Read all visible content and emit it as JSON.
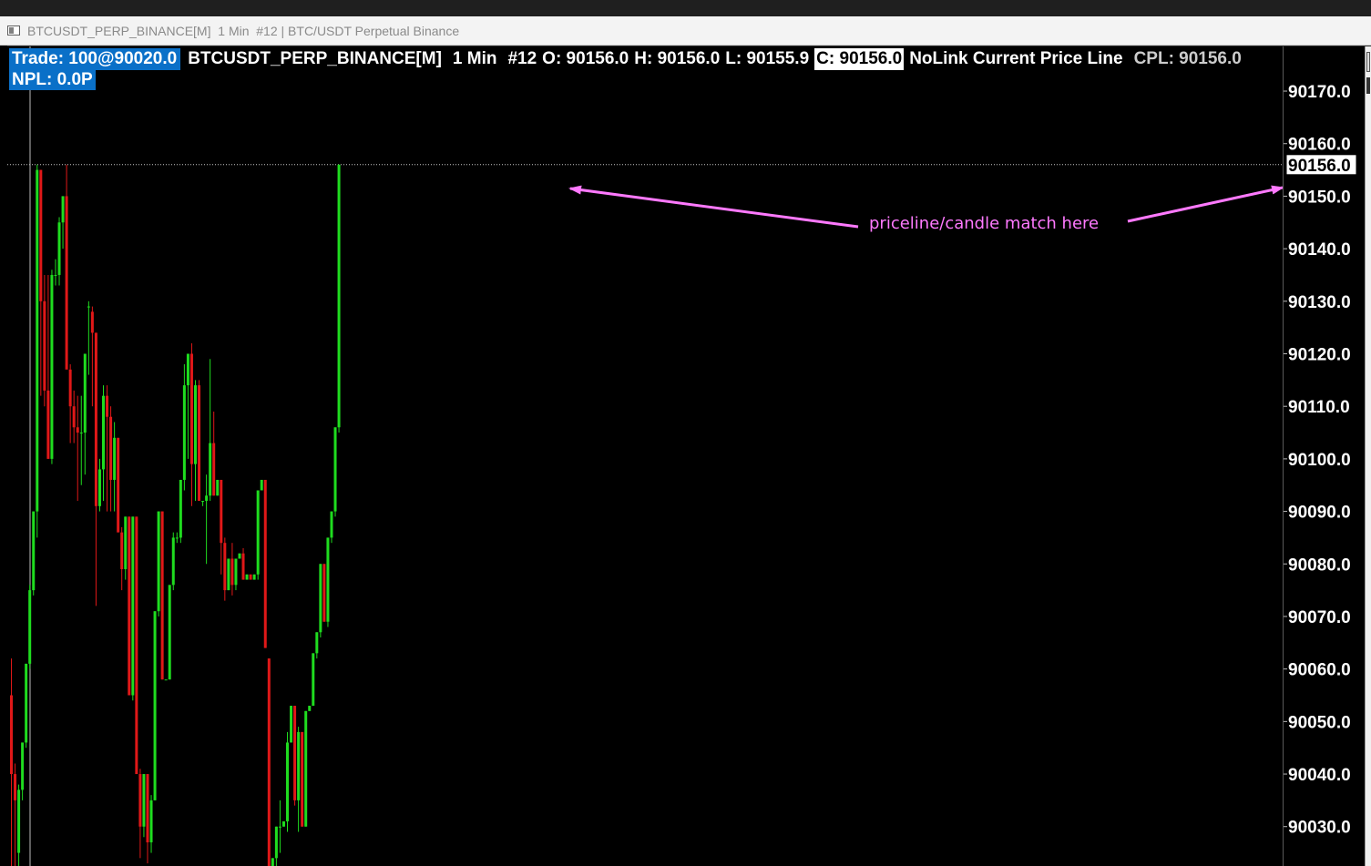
{
  "window": {
    "title": "BTCUSDT_PERP_BINANCE[M]  1 Min  #12 | BTC/USDT Perpetual Binance"
  },
  "info": {
    "trade": "Trade: 100@90020.0",
    "symbol": "BTCUSDT_PERP_BINANCE[M]",
    "interval": "1 Min",
    "bar_count": "#12",
    "open": "O: 90156.0",
    "high": "H: 90156.0",
    "low": "L: 90155.9",
    "close": "C: 90156.0",
    "indicator": "NoLink Current Price Line",
    "cpl": "CPL: 90156.0",
    "npl": "NPL: 0.0P"
  },
  "annotation": {
    "text": "priceline/candle match here",
    "color": "#ff79ff"
  },
  "colors": {
    "up": "#1fdc1f",
    "down": "#e01818",
    "price_line": "#c8c8c8",
    "background": "#000000"
  },
  "current_price": 90156.0,
  "current_price_label": "90156.0",
  "chart_data": {
    "type": "candlestick",
    "y_axis_ticks": [
      "90170.0",
      "90160.0",
      "90150.0",
      "90140.0",
      "90130.0",
      "90120.0",
      "90110.0",
      "90100.0",
      "90090.0",
      "90080.0",
      "90070.0",
      "90060.0",
      "90050.0",
      "90040.0",
      "90030.0"
    ],
    "ylim": [
      90022.5,
      90178.5
    ],
    "candles": [
      {
        "o": 90055,
        "h": 90062,
        "l": 90022,
        "c": 90040
      },
      {
        "o": 90040,
        "h": 90042,
        "l": 90022,
        "c": 90035
      },
      {
        "o": 90025,
        "h": 90038,
        "l": 90022,
        "c": 90037
      },
      {
        "o": 90037,
        "h": 90046,
        "l": 90035,
        "c": 90046
      },
      {
        "o": 90046,
        "h": 90061,
        "l": 90045,
        "c": 90061
      },
      {
        "o": 90061,
        "h": 90076,
        "l": 90060,
        "c": 90075
      },
      {
        "o": 90075,
        "h": 90090,
        "l": 90074,
        "c": 90090
      },
      {
        "o": 90090,
        "h": 90156,
        "l": 90085,
        "c": 90155
      },
      {
        "o": 90155,
        "h": 90155,
        "l": 90112,
        "c": 90130
      },
      {
        "o": 90130,
        "h": 90135,
        "l": 90110,
        "c": 90113
      },
      {
        "o": 90113,
        "h": 90135,
        "l": 90100,
        "c": 90100
      },
      {
        "o": 90100,
        "h": 90136,
        "l": 90099,
        "c": 90135
      },
      {
        "o": 90135,
        "h": 90138,
        "l": 90133,
        "c": 90135
      },
      {
        "o": 90135,
        "h": 90146,
        "l": 90133,
        "c": 90145
      },
      {
        "o": 90145,
        "h": 90150,
        "l": 90140,
        "c": 90150
      },
      {
        "o": 90150,
        "h": 90156,
        "l": 90140,
        "c": 90117
      },
      {
        "o": 90117,
        "h": 90118,
        "l": 90103,
        "c": 90110
      },
      {
        "o": 90110,
        "h": 90113,
        "l": 90103,
        "c": 90106
      },
      {
        "o": 90106,
        "h": 90112,
        "l": 90092,
        "c": 90105
      },
      {
        "o": 90105,
        "h": 90112,
        "l": 90095,
        "c": 90105
      },
      {
        "o": 90105,
        "h": 90116,
        "l": 90097,
        "c": 90120
      },
      {
        "o": 90129,
        "h": 90130,
        "l": 90116,
        "c": 90129
      },
      {
        "o": 90128,
        "h": 90129,
        "l": 90110,
        "c": 90124
      },
      {
        "o": 90124,
        "h": 90124,
        "l": 90072,
        "c": 90091
      },
      {
        "o": 90091,
        "h": 90100,
        "l": 90090,
        "c": 90098
      },
      {
        "o": 90098,
        "h": 90114,
        "l": 90092,
        "c": 90112
      },
      {
        "o": 90112,
        "h": 90114,
        "l": 90090,
        "c": 90108
      },
      {
        "o": 90108,
        "h": 90110,
        "l": 90090,
        "c": 90096
      },
      {
        "o": 90096,
        "h": 90107,
        "l": 90090,
        "c": 90104
      },
      {
        "o": 90104,
        "h": 90104,
        "l": 90088,
        "c": 90086
      },
      {
        "o": 90086,
        "h": 90087,
        "l": 90075,
        "c": 90079
      },
      {
        "o": 90079,
        "h": 90089,
        "l": 90077,
        "c": 90089
      },
      {
        "o": 90089,
        "h": 90089,
        "l": 90055,
        "c": 90055
      },
      {
        "o": 90055,
        "h": 90089,
        "l": 90054,
        "c": 90089
      },
      {
        "o": 90089,
        "h": 90089,
        "l": 90040,
        "c": 90040
      },
      {
        "o": 90040,
        "h": 90041,
        "l": 90024,
        "c": 90030
      },
      {
        "o": 90030,
        "h": 90040,
        "l": 90028,
        "c": 90040
      },
      {
        "o": 90040,
        "h": 90040,
        "l": 90023,
        "c": 90027
      },
      {
        "o": 90027,
        "h": 90036,
        "l": 90025,
        "c": 90035
      },
      {
        "o": 90035,
        "h": 90071,
        "l": 90035,
        "c": 90071
      },
      {
        "o": 90071,
        "h": 90090,
        "l": 90070,
        "c": 90090
      },
      {
        "o": 90090,
        "h": 90090,
        "l": 90058,
        "c": 90058
      },
      {
        "o": 90058,
        "h": 90058,
        "l": 90058,
        "c": 90058
      },
      {
        "o": 90058,
        "h": 90076,
        "l": 90058,
        "c": 90076
      },
      {
        "o": 90076,
        "h": 90086,
        "l": 90075,
        "c": 90085
      },
      {
        "o": 90085,
        "h": 90086,
        "l": 90084,
        "c": 90085
      },
      {
        "o": 90085,
        "h": 90096,
        "l": 90084,
        "c": 90096
      },
      {
        "o": 90096,
        "h": 90118,
        "l": 90094,
        "c": 90114
      },
      {
        "o": 90114,
        "h": 90120,
        "l": 90100,
        "c": 90120
      },
      {
        "o": 90120,
        "h": 90122,
        "l": 90091,
        "c": 90099
      },
      {
        "o": 90099,
        "h": 90115,
        "l": 90092,
        "c": 90114
      },
      {
        "o": 90114,
        "h": 90115,
        "l": 90092,
        "c": 90092
      },
      {
        "o": 90092,
        "h": 90092,
        "l": 90091,
        "c": 90092
      },
      {
        "o": 90092,
        "h": 90097,
        "l": 90080,
        "c": 90093
      },
      {
        "o": 90093,
        "h": 90119,
        "l": 90092,
        "c": 90103
      },
      {
        "o": 90103,
        "h": 90109,
        "l": 90093,
        "c": 90093
      },
      {
        "o": 90093,
        "h": 90096,
        "l": 90093,
        "c": 90096
      },
      {
        "o": 90096,
        "h": 90096,
        "l": 90078,
        "c": 90084
      },
      {
        "o": 90084,
        "h": 90085,
        "l": 90073,
        "c": 90075
      },
      {
        "o": 90075,
        "h": 90081,
        "l": 90075,
        "c": 90081
      },
      {
        "o": 90081,
        "h": 90084,
        "l": 90074,
        "c": 90076
      },
      {
        "o": 90076,
        "h": 90081,
        "l": 90075,
        "c": 90081
      },
      {
        "o": 90081,
        "h": 90082,
        "l": 90081,
        "c": 90082
      },
      {
        "o": 90082,
        "h": 90083,
        "l": 90077,
        "c": 90077
      },
      {
        "o": 90077,
        "h": 90078,
        "l": 90077,
        "c": 90078
      },
      {
        "o": 90078,
        "h": 90078,
        "l": 90077,
        "c": 90077
      },
      {
        "o": 90077,
        "h": 90078,
        "l": 90077,
        "c": 90078
      },
      {
        "o": 90078,
        "h": 90094,
        "l": 90077,
        "c": 90094
      },
      {
        "o": 90094,
        "h": 90096,
        "l": 90094,
        "c": 90096
      },
      {
        "o": 90096,
        "h": 90096,
        "l": 90064,
        "c": 90064
      },
      {
        "o": 90062,
        "h": 90062,
        "l": 90022,
        "c": 90022
      },
      {
        "o": 90022,
        "h": 90024,
        "l": 90022,
        "c": 90024
      },
      {
        "o": 90024,
        "h": 90030,
        "l": 90022,
        "c": 90030
      },
      {
        "o": 90030,
        "h": 90035,
        "l": 90025,
        "c": 90030
      },
      {
        "o": 90030,
        "h": 90031,
        "l": 90030,
        "c": 90031
      },
      {
        "o": 90031,
        "h": 90048,
        "l": 90029,
        "c": 90046
      },
      {
        "o": 90046,
        "h": 90053,
        "l": 90046,
        "c": 90053
      },
      {
        "o": 90053,
        "h": 90053,
        "l": 90034,
        "c": 90035
      },
      {
        "o": 90035,
        "h": 90049,
        "l": 90029,
        "c": 90048
      },
      {
        "o": 90048,
        "h": 90048,
        "l": 90030,
        "c": 90030
      },
      {
        "o": 90030,
        "h": 90052,
        "l": 90030,
        "c": 90052
      },
      {
        "o": 90052,
        "h": 90053,
        "l": 90052,
        "c": 90053
      },
      {
        "o": 90053,
        "h": 90063,
        "l": 90053,
        "c": 90063
      },
      {
        "o": 90063,
        "h": 90067,
        "l": 90062,
        "c": 90067
      },
      {
        "o": 90067,
        "h": 90080,
        "l": 90066,
        "c": 90080
      },
      {
        "o": 90080,
        "h": 90080,
        "l": 90069,
        "c": 90069
      },
      {
        "o": 90069,
        "h": 90085,
        "l": 90068,
        "c": 90085
      },
      {
        "o": 90085,
        "h": 90090,
        "l": 90084,
        "c": 90090
      },
      {
        "o": 90090,
        "h": 90106,
        "l": 90089,
        "c": 90106
      },
      {
        "o": 90106,
        "h": 90156,
        "l": 90105,
        "c": 90156
      }
    ]
  }
}
